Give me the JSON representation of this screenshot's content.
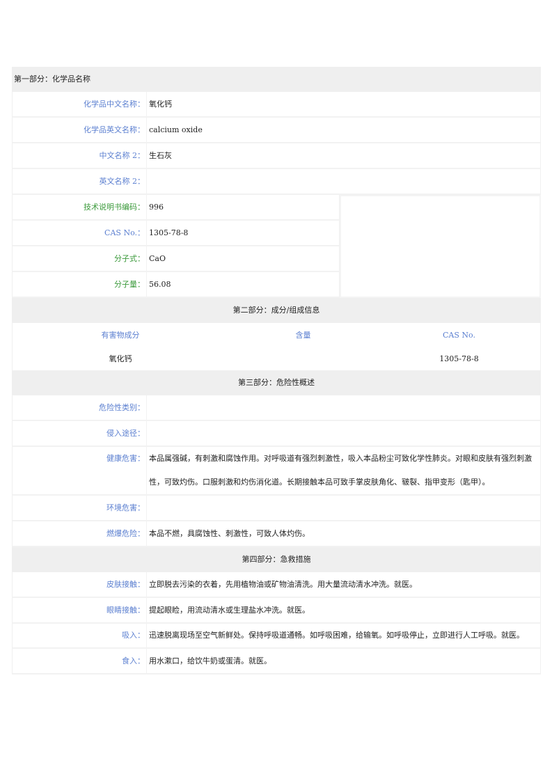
{
  "sections": {
    "s1": {
      "title": "第一部分：化学品名称",
      "rows": [
        {
          "label": "化学品中文名称：",
          "value": "氧化钙"
        },
        {
          "label": "化学品英文名称：",
          "value": "calcium oxide"
        },
        {
          "label": "中文名称 2：",
          "value": "生石灰"
        },
        {
          "label": "英文名称 2：",
          "value": ""
        },
        {
          "label": "技术说明书编码：",
          "value": "996"
        },
        {
          "label": "CAS No.：",
          "value": "1305-78-8"
        },
        {
          "label": "分子式：",
          "value": "CaO"
        },
        {
          "label": "分子量：",
          "value": "56.08"
        }
      ]
    },
    "s2": {
      "title": "第二部分：成分/组成信息",
      "headers": [
        "有害物成分",
        "含量",
        "CAS No."
      ],
      "rows": [
        [
          "氧化钙",
          "",
          "1305-78-8"
        ]
      ]
    },
    "s3": {
      "title": "第三部分：危险性概述",
      "rows": [
        {
          "label": "危险性类别：",
          "value": ""
        },
        {
          "label": "侵入途径：",
          "value": ""
        },
        {
          "label": "健康危害：",
          "value": "本品属强碱，有刺激和腐蚀作用。对呼吸道有强烈刺激性，吸入本品粉尘可致化学性肺炎。对眼和皮肤有强烈刺激性，可致灼伤。口服刺激和灼伤消化道。长期接触本品可致手掌皮肤角化、皲裂、指甲变形（匙甲）。"
        },
        {
          "label": "环境危害：",
          "value": ""
        },
        {
          "label": "燃爆危险：",
          "value": "本品不燃，具腐蚀性、刺激性，可致人体灼伤。"
        }
      ]
    },
    "s4": {
      "title": "第四部分：急救措施",
      "rows": [
        {
          "label": "皮肤接触：",
          "value": "立即脱去污染的衣着，先用植物油或矿物油清洗。用大量流动清水冲洗。就医。"
        },
        {
          "label": "眼睛接触：",
          "value": "提起眼睑，用流动清水或生理盐水冲洗。就医。"
        },
        {
          "label": "吸入：",
          "value": "迅速脱离现场至空气新鲜处。保持呼吸道通畅。如呼吸困难，给输氧。如呼吸停止，立即进行人工呼吸。就医。"
        },
        {
          "label": "食入：",
          "value": "用水漱口，给饮牛奶或蛋清。就医。"
        }
      ]
    }
  },
  "colors": {
    "label_blue": "#5b7fd0",
    "label_green": "#3b9a3b",
    "section_bg": "#efefef"
  }
}
